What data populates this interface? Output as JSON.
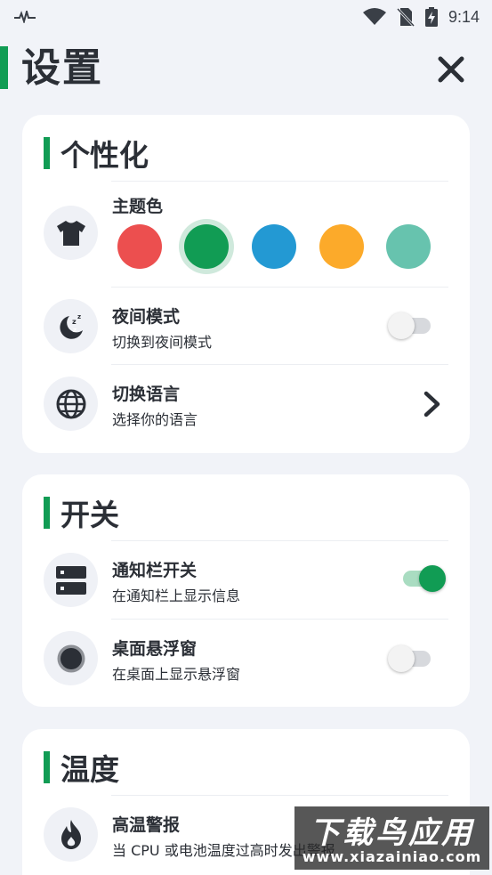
{
  "status_bar": {
    "time": "9:14",
    "icons": [
      "activity-icon",
      "wifi-icon",
      "no-sim-icon",
      "battery-charging-icon"
    ]
  },
  "header": {
    "title": "设置",
    "close_icon": "close-icon"
  },
  "colors": {
    "accent": "#119c54",
    "background": "#f1f3f8",
    "card": "#ffffff"
  },
  "sections": {
    "personalization": {
      "title": "个性化",
      "theme_color": {
        "title": "主题色",
        "icon": "shirt-icon",
        "swatches": [
          "#ec4f4f",
          "#119c54",
          "#2399d3",
          "#fcaa2a",
          "#67c3ae"
        ],
        "selected_index": 1
      },
      "night_mode": {
        "title": "夜间模式",
        "subtitle": "切换到夜间模式",
        "icon": "moon-sleep-icon",
        "enabled": false
      },
      "language": {
        "title": "切换语言",
        "subtitle": "选择你的语言",
        "icon": "globe-icon"
      }
    },
    "switches": {
      "title": "开关",
      "notification_bar": {
        "title": "通知栏开关",
        "subtitle": "在通知栏上显示信息",
        "icon": "server-icon",
        "enabled": true
      },
      "floating_window": {
        "title": "桌面悬浮窗",
        "subtitle": "在桌面上显示悬浮窗",
        "icon": "floating-dot-icon",
        "enabled": false
      }
    },
    "temperature": {
      "title": "温度",
      "high_temp_alert": {
        "title": "高温警报",
        "subtitle": "当 CPU 或电池温度过高时发出警报",
        "icon": "flame-icon"
      }
    }
  },
  "watermark": {
    "line1": "下载鸟应用",
    "line2": "www.xiazainiao.com"
  }
}
